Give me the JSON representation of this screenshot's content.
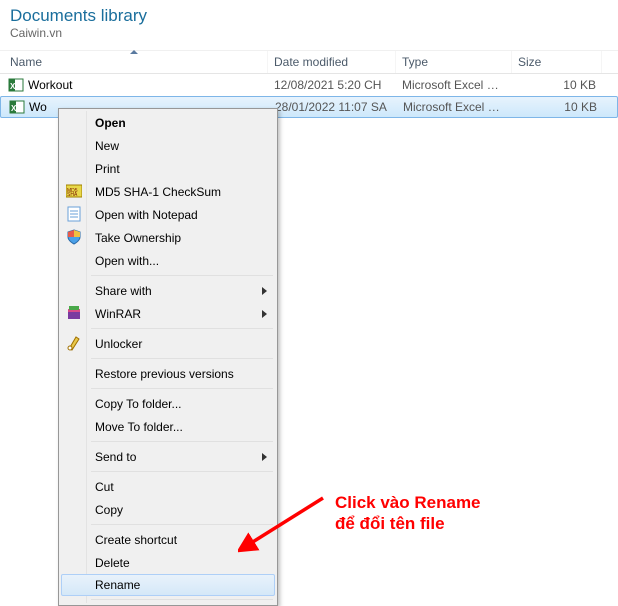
{
  "header": {
    "title": "Documents library",
    "subtitle": "Caiwin.vn"
  },
  "columns": {
    "name": "Name",
    "date": "Date modified",
    "type": "Type",
    "size": "Size"
  },
  "files": [
    {
      "name": "Workout",
      "date": "12/08/2021 5:20 CH",
      "type": "Microsoft Excel W...",
      "size": "10 KB",
      "selected": false
    },
    {
      "name": "Wo",
      "date": "28/01/2022 11:07 SA",
      "type": "Microsoft Excel W...",
      "size": "10 KB",
      "selected": true
    }
  ],
  "context_menu": {
    "open": "Open",
    "new": "New",
    "print": "Print",
    "md5": "MD5 SHA-1 CheckSum",
    "notepad": "Open with Notepad",
    "take_ownership": "Take Ownership",
    "open_with": "Open with...",
    "share_with": "Share with",
    "winrar": "WinRAR",
    "unlocker": "Unlocker",
    "restore": "Restore previous versions",
    "copy_to": "Copy To folder...",
    "move_to": "Move To folder...",
    "send_to": "Send to",
    "cut": "Cut",
    "copy": "Copy",
    "shortcut": "Create shortcut",
    "delete": "Delete",
    "rename": "Rename"
  },
  "annotation": {
    "line1": "Click vào Rename",
    "line2": "để đổi tên file"
  }
}
